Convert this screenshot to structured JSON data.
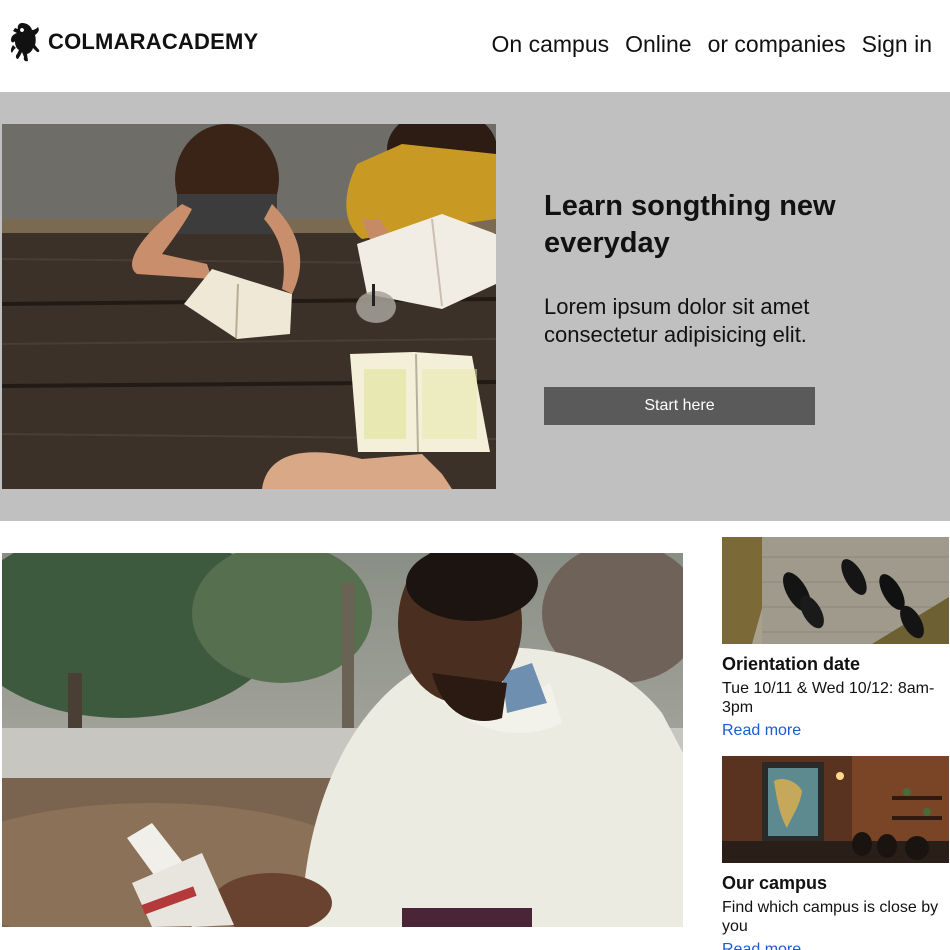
{
  "brand": {
    "name": "COLMARACADEMY",
    "logo_icon": "lion-rampant-icon"
  },
  "nav": {
    "items": [
      "On campus",
      "Online",
      "or companies",
      "Sign in"
    ]
  },
  "hero": {
    "title": "Learn songthing new everyday",
    "text": "Lorem ipsum dolor sit amet consectetur adipisicing elit.",
    "button_label": "Start here"
  },
  "cards": [
    {
      "title": "Orientation date",
      "text": "Tue 10/11 & Wed 10/12: 8am-3pm",
      "link": "Read more"
    },
    {
      "title": "Our campus",
      "text": "Find which campus is close by you",
      "link": "Read more"
    }
  ],
  "colors": {
    "hero_bg": "#c0c0c0",
    "button_bg": "#5a5a5a",
    "link": "#1a5bd6"
  }
}
